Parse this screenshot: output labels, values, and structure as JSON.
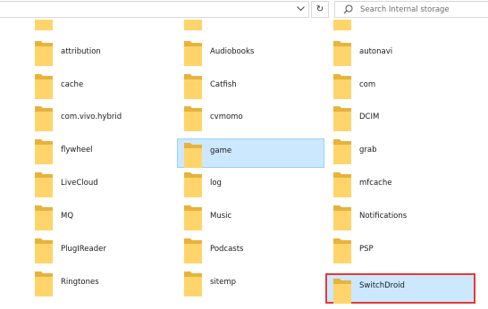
{
  "toolbar": {
    "search_placeholder": "Search Internal storage",
    "refresh_glyph": "↻",
    "chevron_glyph": "⌄"
  },
  "icons": {
    "folder": "folder-icon",
    "search": "search-icon",
    "refresh": "refresh-icon",
    "chevron": "chevron-down-icon"
  },
  "colors": {
    "folder_back": "#E8B23B",
    "folder_front": "#FFD56B",
    "selection_fill": "#cce8ff",
    "selection_border": "#99d1ff",
    "highlight_border": "#e53935"
  },
  "columns": [
    {
      "items": [
        {
          "label": "attribution"
        },
        {
          "label": "cache"
        },
        {
          "label": "com.vivo.hybrid"
        },
        {
          "label": "flywheel"
        },
        {
          "label": "LiveCloud"
        },
        {
          "label": "MQ"
        },
        {
          "label": "PlugIReader"
        },
        {
          "label": "Ringtones"
        }
      ]
    },
    {
      "items": [
        {
          "label": "Audiobooks"
        },
        {
          "label": "Catfish"
        },
        {
          "label": "cvmomo"
        },
        {
          "label": "game",
          "selected": true
        },
        {
          "label": "log"
        },
        {
          "label": "Music"
        },
        {
          "label": "Podcasts"
        },
        {
          "label": "sitemp"
        }
      ]
    },
    {
      "items": [
        {
          "label": "autonavi"
        },
        {
          "label": "com"
        },
        {
          "label": "DCIM"
        },
        {
          "label": "grab"
        },
        {
          "label": "mfcache"
        },
        {
          "label": "Notifications"
        },
        {
          "label": "PSP"
        },
        {
          "label": "SwitchDroid",
          "highlighted": true
        }
      ]
    }
  ]
}
